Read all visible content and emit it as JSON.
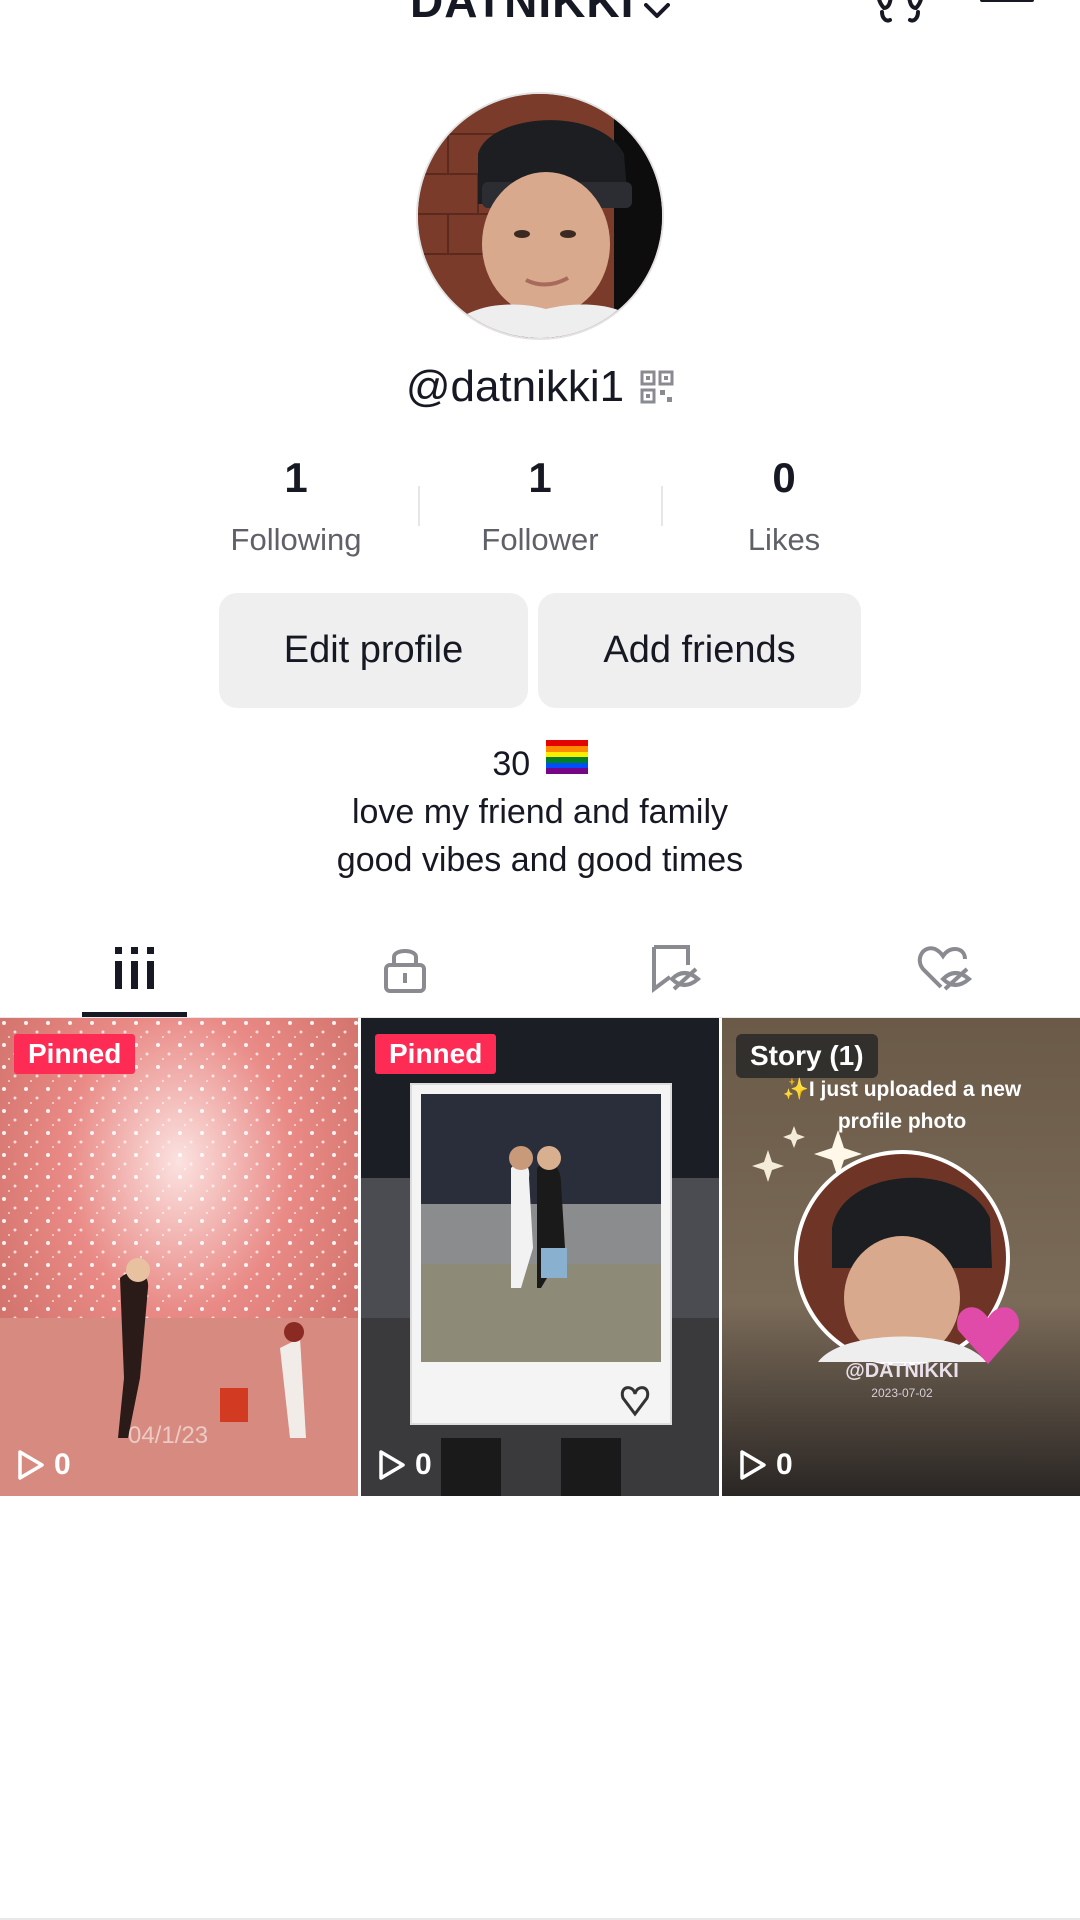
{
  "header": {
    "title": "DATNIKKI",
    "footprint_icon": "footprint-icon",
    "menu_icon": "hamburger-menu-icon"
  },
  "profile": {
    "handle": "@datnikki1",
    "qr_icon": "qr-code-icon"
  },
  "stats": [
    {
      "value": "1",
      "label": "Following"
    },
    {
      "value": "1",
      "label": "Follower"
    },
    {
      "value": "0",
      "label": "Likes"
    }
  ],
  "buttons": {
    "edit": "Edit profile",
    "add": "Add friends"
  },
  "bio": {
    "line1": "30",
    "line1_icon": "rainbow-flag-icon",
    "line2": "love my friend and family",
    "line3": "good vibes and good times"
  },
  "tabs": [
    {
      "icon": "videos-grid-icon",
      "active": true
    },
    {
      "icon": "lock-icon",
      "active": false
    },
    {
      "icon": "hidden-bookmark-icon",
      "active": false
    },
    {
      "icon": "hidden-heart-icon",
      "active": false
    }
  ],
  "videos": [
    {
      "badge": "Pinned",
      "views": "0",
      "overlay_text": "04/1/23"
    },
    {
      "badge": "Pinned",
      "views": "0"
    },
    {
      "badge": "Story (1)",
      "views": "0",
      "story_caption": "✨I just uploaded a new profile photo",
      "story_handle": "@DATNIKKI",
      "story_date": "2023-07-02"
    }
  ],
  "colors": {
    "accent": "#fe2c55",
    "text": "#161823",
    "secondary_text": "#5f6068",
    "button_bg": "#efeff0"
  }
}
